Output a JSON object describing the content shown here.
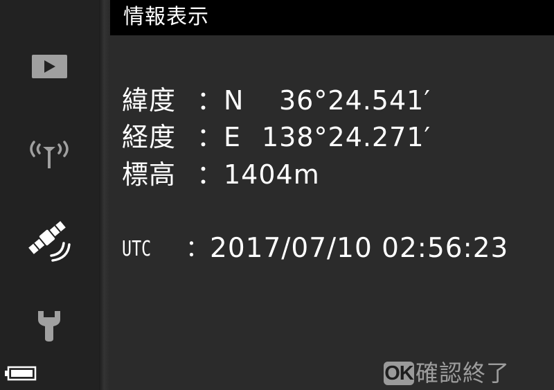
{
  "header": {
    "title": "情報表示"
  },
  "sidebar": {
    "items": [
      {
        "name": "playback",
        "icon": "play-icon"
      },
      {
        "name": "wireless",
        "icon": "wifi-antenna-icon"
      },
      {
        "name": "gps",
        "icon": "satellite-icon"
      },
      {
        "name": "setup",
        "icon": "wrench-icon"
      }
    ],
    "active": "gps",
    "battery_icon": "battery-icon"
  },
  "info": {
    "latitude": {
      "label": "緯度",
      "hemisphere": "N",
      "value": "36°24.541′"
    },
    "longitude": {
      "label": "経度",
      "hemisphere": "E",
      "value": "138°24.271′"
    },
    "altitude": {
      "label": "標高",
      "value": "1404m"
    },
    "separator": "：",
    "utc": {
      "label": "UTC",
      "separator": "：",
      "value": "2017/07/10  02:56:23"
    }
  },
  "footer": {
    "ok_badge": "OK",
    "ok_text": "確認終了"
  },
  "colors": {
    "background": "#2b2b2b",
    "sidebar": "#222222",
    "title_bar": "#000000",
    "text": "#ffffff",
    "inactive_icon": "#a0a0a0",
    "hint_text": "#9d9d9d"
  }
}
